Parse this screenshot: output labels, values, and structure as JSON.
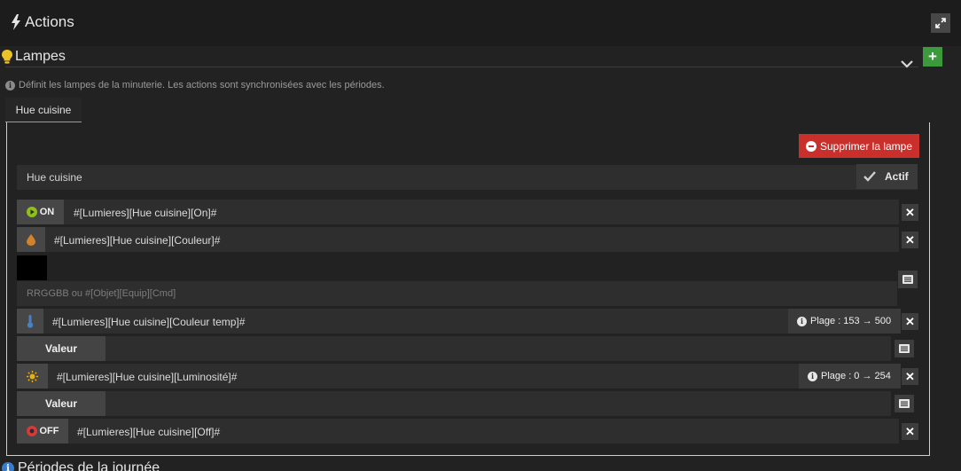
{
  "panel": {
    "title": "Actions",
    "expand_icon": "expand-icon"
  },
  "section": {
    "title": "Lampes",
    "hint": "Définit les lampes de la minuterie. Les actions sont synchronisées avec les périodes.",
    "add_label": "+"
  },
  "tabs": [
    {
      "label": "Hue cuisine"
    }
  ],
  "lamp": {
    "delete_label": "Supprimer la lampe",
    "name": "Hue cuisine",
    "actif_label": "Actif",
    "commands": {
      "on": {
        "label": "ON",
        "value": "#[Lumieres][Hue cuisine][On]#",
        "color": "#8fc01a"
      },
      "couleur": {
        "value": "#[Lumieres][Hue cuisine][Couleur]#",
        "icon_color": "#d2822a"
      },
      "color_input": {
        "value": "",
        "placeholder": "RRGGBB ou #[Objet][Equip][Cmd]",
        "swatch": "#000000"
      },
      "couleur_temp": {
        "value": "#[Lumieres][Hue cuisine][Couleur temp]#",
        "plage": "Plage : 153 → 500",
        "icon_color": "#4a7fc2"
      },
      "temp_valeur": {
        "label": "Valeur"
      },
      "luminosite": {
        "value": "#[Lumieres][Hue cuisine][Luminosité]#",
        "plage": "Plage : 0 → 254",
        "icon_color": "#e0b020"
      },
      "lum_valeur": {
        "label": "Valeur"
      },
      "off": {
        "label": "OFF",
        "value": "#[Lumieres][Hue cuisine][Off]#",
        "color": "#d43a3a"
      }
    }
  },
  "next_section": {
    "title": "Périodes de la journée"
  }
}
